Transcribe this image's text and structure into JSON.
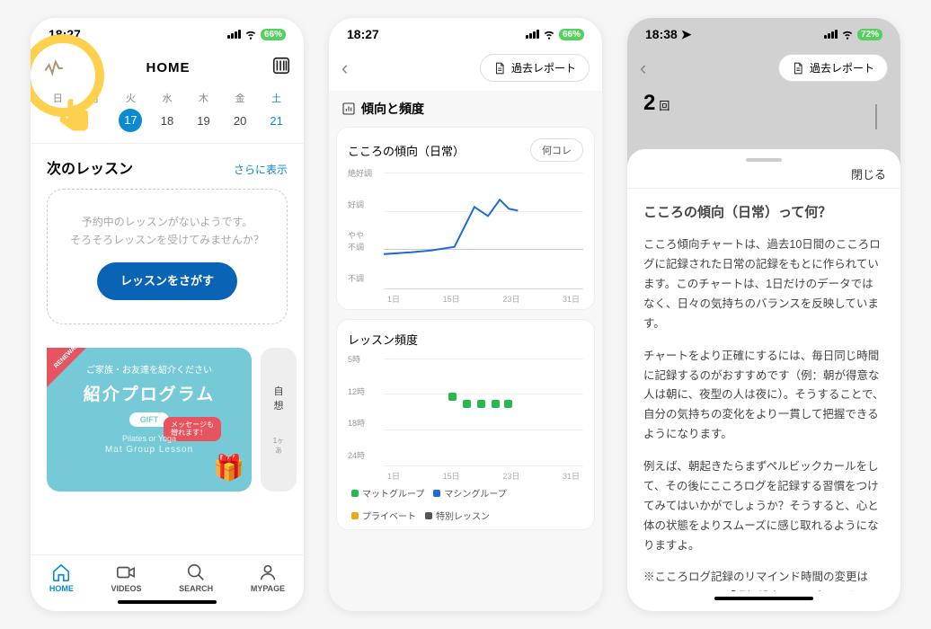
{
  "phone1": {
    "status": {
      "time": "18:27",
      "battery": "66%"
    },
    "header": {
      "title": "HOME"
    },
    "calendar": {
      "days": [
        "日",
        "月",
        "火",
        "水",
        "木",
        "金",
        "土"
      ],
      "dates": [
        "",
        "",
        "17",
        "18",
        "19",
        "20",
        "21"
      ],
      "today_index": 2
    },
    "next_lesson": {
      "title": "次のレッスン",
      "more": "さらに表示",
      "empty_line1": "予約中のレッスンがないようです。",
      "empty_line2": "そろそろレッスンを受けてみませんか？",
      "button": "レッスンをさがす"
    },
    "promo": {
      "ribbon": "RENEWAL",
      "sub": "ご家族・お友達を紹介ください",
      "title": "紹介プログラム",
      "pill": "GIFT",
      "balloon": "メッセージも\n贈れます！",
      "small": "Pilates or Yoga",
      "bottom": "Mat Group Lesson",
      "side_line1": "自",
      "side_line2": "想",
      "side_small": "1ヶ\nあ"
    },
    "tabs": {
      "home": "HOME",
      "videos": "VIDEOS",
      "search": "SEARCH",
      "mypage": "MYPAGE"
    }
  },
  "phone2": {
    "status": {
      "time": "18:27",
      "battery": "66%"
    },
    "header": {
      "past_reports": "過去レポート"
    },
    "trend": {
      "section_title": "傾向と頻度",
      "card_title": "こころの傾向（日常）",
      "help": "何コレ",
      "y_labels": [
        "絶好調",
        "好調",
        "やや\n不調",
        "不調"
      ],
      "x_labels": [
        "1日",
        "15日",
        "23日",
        "31日"
      ]
    },
    "freq": {
      "card_title": "レッスン頻度",
      "y_labels": [
        "5時",
        "12時",
        "18時",
        "24時"
      ],
      "x_labels": [
        "1日",
        "15日",
        "23日",
        "31日"
      ],
      "legend": {
        "mat": "マットグループ",
        "machine": "マシングループ",
        "private": "プライベート",
        "special": "特別レッスン"
      },
      "colors": {
        "mat": "#27b94c",
        "machine": "#1e6bd6",
        "private": "#f0a818",
        "special": "#555555"
      }
    }
  },
  "phone3": {
    "status": {
      "time": "18:38",
      "battery": "72%"
    },
    "header": {
      "past_reports": "過去レポート"
    },
    "count": {
      "value": "2",
      "unit": "回"
    },
    "sheet": {
      "close": "閉じる",
      "title": "こころの傾向（日常）って何？",
      "p1": "こころ傾向チャートは、過去10日間のこころログに記録された日常の記録をもとに作られています。このチャートは、1日だけのデータではなく、日々の気持ちのバランスを反映しています。",
      "p2": "チャートをより正確にするには、毎日同じ時間に記録するのがおすすめです（例：朝が得意な人は朝に、夜型の人は夜に）。そうすることで、自分の気持ちの変化をより一貫して把握できるようになります。",
      "p3": "例えば、朝起きたらまずペルビックカールをして、その後にこころログを記録する習慣をつけてみてはいかがでしょうか？そうすると、心と体の状態をよりスムーズに感じ取れるようになりますよ。",
      "p4": "※こころログ記録のリマインド時間の変更はMYPAGEにある「通知設定」から変えられます。"
    }
  },
  "chart_data": [
    {
      "type": "line",
      "title": "こころの傾向（日常）",
      "y_categories": [
        "不調",
        "やや不調",
        "好調",
        "絶好調"
      ],
      "x": [
        1,
        5,
        8,
        12,
        15,
        17,
        19,
        20,
        21
      ],
      "y_index": [
        1,
        1.1,
        1.2,
        1.4,
        2.4,
        2.1,
        2.6,
        2.3,
        2.2
      ],
      "x_range": [
        1,
        31
      ]
    },
    {
      "type": "scatter",
      "title": "レッスン頻度",
      "y_axis": "hour_of_day",
      "ylim": [
        5,
        24
      ],
      "x_range": [
        1,
        31
      ],
      "legend": [
        "マットグループ",
        "マシングループ",
        "プライベート",
        "特別レッスン"
      ],
      "series": [
        {
          "name": "マットグループ",
          "color": "#27b94c",
          "points": [
            [
              12,
              11
            ],
            [
              14,
              12
            ],
            [
              16,
              12
            ],
            [
              18,
              12
            ],
            [
              20,
              12
            ]
          ]
        }
      ]
    }
  ]
}
